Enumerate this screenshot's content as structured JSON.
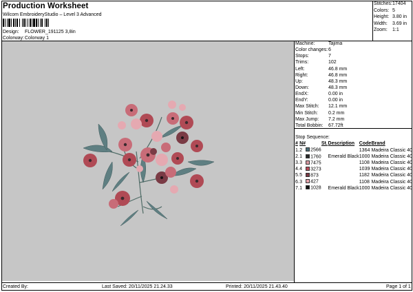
{
  "header": {
    "title": "Production Worksheet",
    "subtitle": "Wilcom EmbroideryStudio – Level 3 Advanced",
    "design_label": "Design:",
    "design_value": "FLOWER_191125 3,8in",
    "colorway_label": "Colorway:",
    "colorway_value": "Colorway 1"
  },
  "summary": {
    "stitches_label": "Stitches:",
    "stitches": "17404",
    "colors_label": "Colors:",
    "colors": "5",
    "height_label": "Height:",
    "height": "3.80 in",
    "width_label": "Width:",
    "width": "3.69 in",
    "zoom_label": "Zoom:",
    "zoom": "1:1"
  },
  "machine_info": [
    {
      "label": "Machine:",
      "value": "Tajima"
    },
    {
      "label": "Color changes:",
      "value": "6"
    },
    {
      "label": "Stops:",
      "value": "7"
    },
    {
      "label": "Trims:",
      "value": "102"
    },
    {
      "label": "Left:",
      "value": "46.8 mm"
    },
    {
      "label": "Right:",
      "value": "46.8 mm"
    },
    {
      "label": "Up:",
      "value": "48.3 mm"
    },
    {
      "label": "Down:",
      "value": "48.3 mm"
    },
    {
      "label": "EndX:",
      "value": "0.00 in"
    },
    {
      "label": "EndY:",
      "value": "0.00 in"
    },
    {
      "label": "Max Stitch:",
      "value": "12.1 mm"
    },
    {
      "label": "Min Stitch:",
      "value": "0.2 mm"
    },
    {
      "label": "Max Jump:",
      "value": "7.2 mm"
    },
    {
      "label": "Total Bobbin:",
      "value": "67.72ft"
    }
  ],
  "stop_sequence": {
    "title": "Stop Sequence:",
    "columns": [
      "#",
      "N#",
      "",
      "St.",
      "Description",
      "Code",
      "Brand"
    ],
    "rows": [
      {
        "num": "1.",
        "n": "2",
        "color": "#4a6e78",
        "code_no": "2566",
        "st": "",
        "desc": "",
        "code": "1364",
        "brand": "Madeira Classic 40"
      },
      {
        "num": "2.",
        "n": "1",
        "color": "#2a2a2a",
        "code_no": "1760",
        "st": "",
        "desc": "Emerald Black",
        "code": "1000",
        "brand": "Madeira Classic 40"
      },
      {
        "num": "3.",
        "n": "3",
        "color": "#d89aa3",
        "code_no": "7475",
        "st": "",
        "desc": "",
        "code": "1108",
        "brand": "Madeira Classic 40"
      },
      {
        "num": "4.",
        "n": "4",
        "color": "#b84a58",
        "code_no": "3273",
        "st": "",
        "desc": "",
        "code": "1039",
        "brand": "Madeira Classic 40"
      },
      {
        "num": "5.",
        "n": "5",
        "color": "#7a3b45",
        "code_no": "873",
        "st": "",
        "desc": "",
        "code": "1182",
        "brand": "Madeira Classic 40"
      },
      {
        "num": "6.",
        "n": "3",
        "color": "#e6a4ad",
        "code_no": "427",
        "st": "",
        "desc": "",
        "code": "1108",
        "brand": "Madeira Classic 40"
      },
      {
        "num": "7.",
        "n": "1",
        "color": "#111111",
        "code_no": "1028",
        "st": "",
        "desc": "Emerald Black",
        "code": "1000",
        "brand": "Madeira Classic 40"
      }
    ]
  },
  "footer": {
    "created": "Created By:",
    "saved": "Last Saved: 20/11/2025 21.24.33",
    "printed": "Printed: 20/11/2025 21.43.40",
    "page": "Page 1 of 1"
  },
  "colors": {
    "preview_bg": "#c6c6c6",
    "leaf": "#5f7f82",
    "petal_dark": "#b04a55",
    "petal_light": "#e5a9b1",
    "petal_mid": "#c86c78",
    "center": "#3a2a2e"
  }
}
